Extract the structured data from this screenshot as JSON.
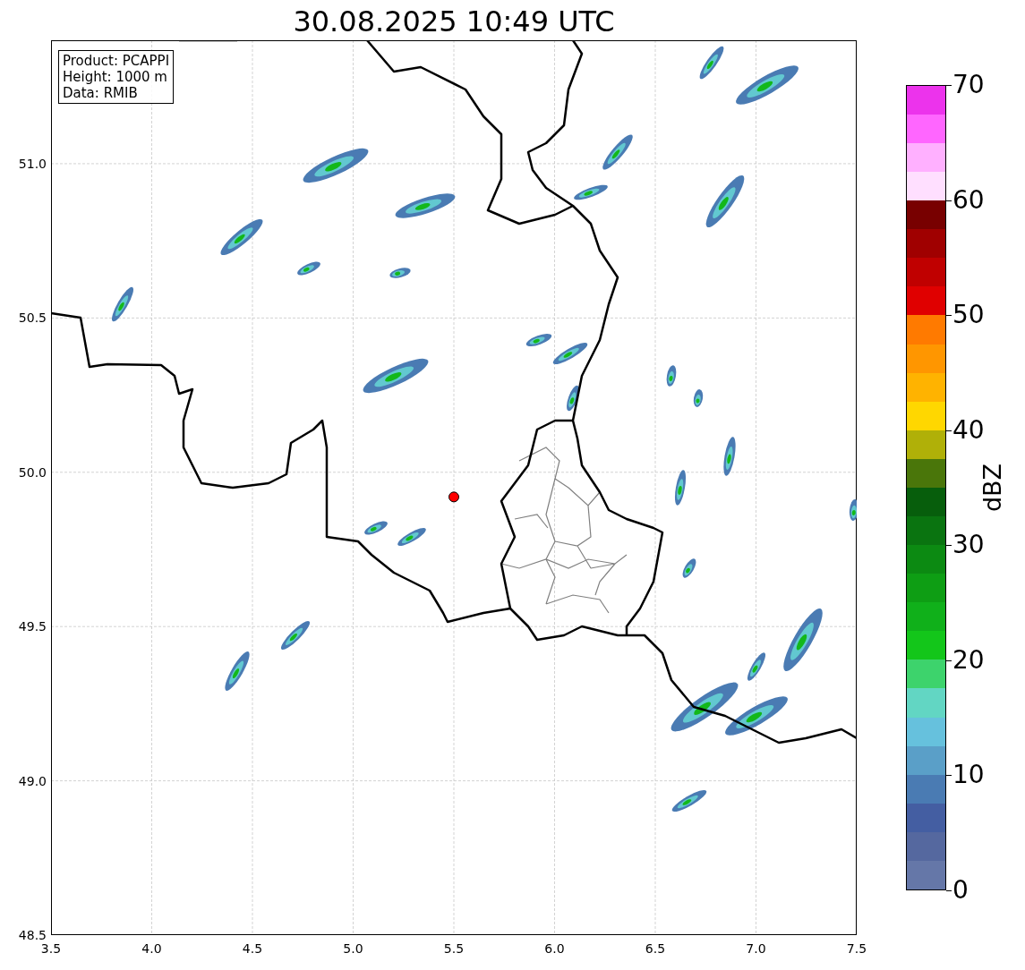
{
  "plot": {
    "title": "30.08.2025 10:49 UTC",
    "info_box": {
      "lines": [
        "Product: PCAPPI",
        "Height: 1000 m",
        "Data: RMIB"
      ]
    },
    "chart_data": {
      "type": "scatter",
      "grid": true,
      "xlim": [
        3.5,
        7.5
      ],
      "ylim": [
        48.5,
        51.4
      ],
      "xticks": [
        {
          "value": 3.5,
          "label": "3.5"
        },
        {
          "value": 4.0,
          "label": "4.0"
        },
        {
          "value": 4.5,
          "label": "4.5"
        },
        {
          "value": 5.0,
          "label": "5.0"
        },
        {
          "value": 5.5,
          "label": "5.5"
        },
        {
          "value": 6.0,
          "label": "6.0"
        },
        {
          "value": 6.5,
          "label": "6.5"
        },
        {
          "value": 7.0,
          "label": "7.0"
        },
        {
          "value": 7.5,
          "label": "7.5"
        }
      ],
      "yticks": [
        {
          "value": 48.5,
          "label": "48.5"
        },
        {
          "value": 49.0,
          "label": "49.0"
        },
        {
          "value": 49.5,
          "label": "49.5"
        },
        {
          "value": 50.0,
          "label": "50.0"
        },
        {
          "value": 50.5,
          "label": "50.5"
        },
        {
          "value": 51.0,
          "label": "51.0"
        }
      ],
      "x": [
        5.5
      ],
      "series": [
        {
          "color": "#ff0000",
          "values": [
            49.92
          ]
        }
      ]
    }
  },
  "colorbar": {
    "label": "dBZ",
    "ticks": [
      "70",
      "60",
      "50",
      "40",
      "30",
      "20",
      "10",
      "0"
    ],
    "bands": [
      {
        "color": "#6577a8"
      },
      {
        "color": "#55689f"
      },
      {
        "color": "#445ea2"
      },
      {
        "color": "#4a7bb3"
      },
      {
        "color": "#5a9fc8"
      },
      {
        "color": "#66c1dd"
      },
      {
        "color": "#62d6c3"
      },
      {
        "color": "#3dd36c"
      },
      {
        "color": "#13c61a"
      },
      {
        "color": "#10b01a"
      },
      {
        "color": "#0e9e14"
      },
      {
        "color": "#0c8a12"
      },
      {
        "color": "#0a7410"
      },
      {
        "color": "#075e0c"
      },
      {
        "color": "#4a760a"
      },
      {
        "color": "#b0b008"
      },
      {
        "color": "#ffd700"
      },
      {
        "color": "#ffb300"
      },
      {
        "color": "#ff9600"
      },
      {
        "color": "#ff7a00"
      },
      {
        "color": "#e00000"
      },
      {
        "color": "#c00000"
      },
      {
        "color": "#a00000"
      },
      {
        "color": "#780000"
      },
      {
        "color": "#ffdfff"
      },
      {
        "color": "#ffb0ff"
      },
      {
        "color": "#ff66ff"
      },
      {
        "color": "#ec33ec"
      }
    ]
  }
}
